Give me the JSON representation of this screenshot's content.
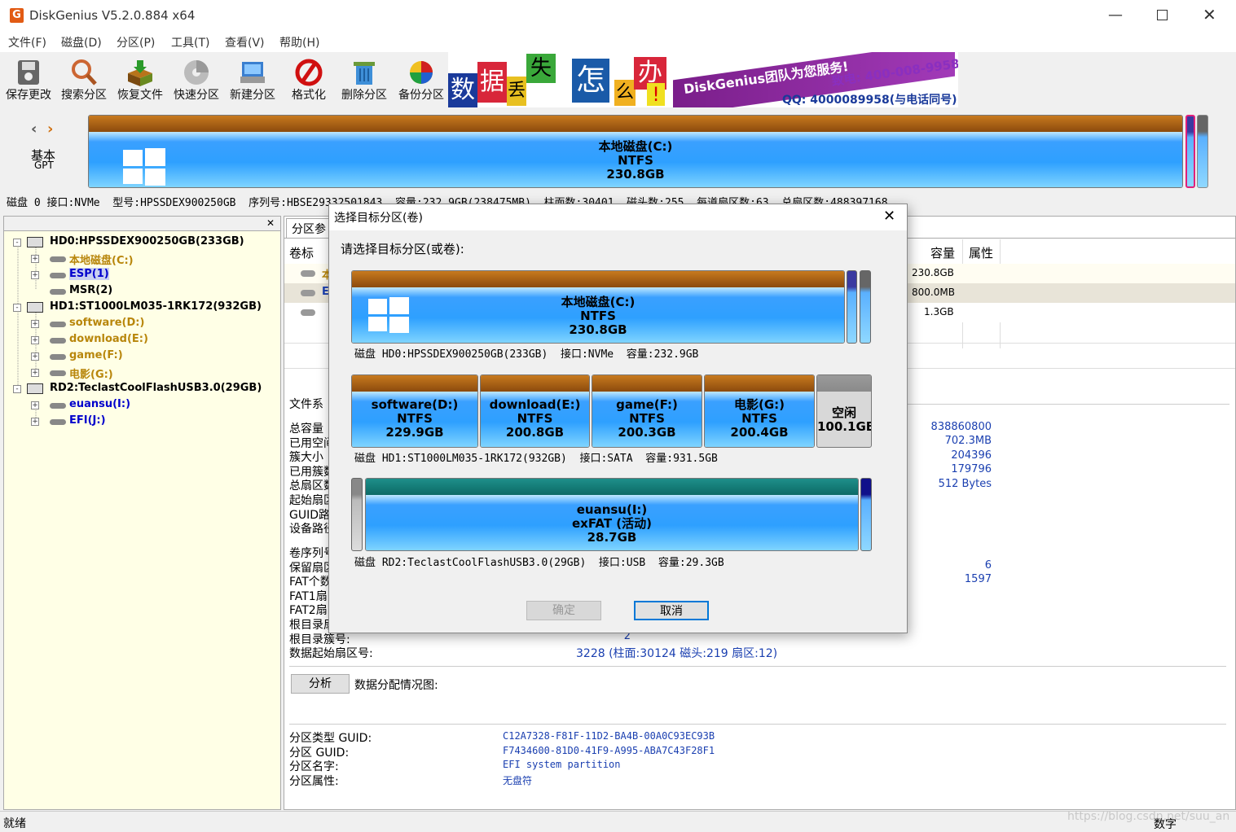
{
  "app": {
    "title": "DiskGenius V5.2.0.884 x64"
  },
  "menu": [
    "文件(F)",
    "磁盘(D)",
    "分区(P)",
    "工具(T)",
    "查看(V)",
    "帮助(H)"
  ],
  "toolbar": {
    "items": [
      "保存更改",
      "搜索分区",
      "恢复文件",
      "快速分区",
      "新建分区",
      "格式化",
      "删除分区",
      "备份分区"
    ],
    "banner": {
      "chars": [
        "数",
        "据",
        "丢",
        "失",
        "怎",
        "么",
        "办",
        "!"
      ],
      "brand": "DiskGenius团队为您服务!",
      "phone": "致电: 400-008-9958",
      "qq": "QQ: 4000089958(与电话同号)"
    }
  },
  "diskmap": {
    "nav_label": "基本",
    "nav_sub": "GPT",
    "partition_name": "本地磁盘(C:)",
    "partition_fs": "NTFS",
    "partition_size": "230.8GB"
  },
  "diskinfo": "磁盘 0 接口:NVMe  型号:HPSSDEX900250GB  序列号:HBSE29332501843  容量:232.9GB(238475MB)  柱面数:30401  磁头数:255  每道扇区数:63  总扇区数:488397168",
  "tree": [
    {
      "label": "HD0:HPSSDEX900250GB(233GB)",
      "color": "k"
    },
    {
      "label": "本地磁盘(C:)",
      "color": "o"
    },
    {
      "label": "ESP(1)",
      "color": "b"
    },
    {
      "label": "MSR(2)",
      "color": "k"
    },
    {
      "label": "HD1:ST1000LM035-1RK172(932GB)",
      "color": "k"
    },
    {
      "label": "software(D:)",
      "color": "o"
    },
    {
      "label": "download(E:)",
      "color": "o"
    },
    {
      "label": "game(F:)",
      "color": "o"
    },
    {
      "label": "电影(G:)",
      "color": "o"
    },
    {
      "label": "RD2:TeclastCoolFlashUSB3.0(29GB)",
      "color": "k"
    },
    {
      "label": "euansu(I:)",
      "color": "b"
    },
    {
      "label": "EFI(J:)",
      "color": "b"
    }
  ],
  "right": {
    "tab": "分区参",
    "col_vol": "卷标",
    "col_cap": "容量",
    "col_attr": "属性",
    "rows": [
      {
        "label": "本",
        "cap": "230.8GB"
      },
      {
        "label": "E",
        "cap": "800.0MB"
      },
      {
        "label": "",
        "cap": "1.3GB"
      }
    ],
    "fs_label": "文件系",
    "params": [
      "总容量",
      "已用空间",
      "簇大小",
      "已用簇数",
      "总扇区数",
      "起始扇区",
      "GUID路径",
      "设备路径"
    ],
    "param_vals": [
      "838860800",
      "702.3MB",
      "204396",
      "179796",
      "512 Bytes"
    ],
    "params2": [
      "卷序列号",
      "保留扇区",
      "FAT个数",
      "FAT1扇区",
      "FAT2扇区",
      "根目录扇",
      "根目录簇号:",
      "数据起始扇区号:"
    ],
    "param2_vals": [
      "6",
      "1597"
    ],
    "root_cluster": "2",
    "data_start": "3228 (柱面:30124 磁头:219 扇区:12)",
    "analyze_btn": "分析",
    "alloc_label": "数据分配情况图:",
    "guid_labels": [
      "分区类型 GUID:",
      "分区 GUID:",
      "分区名字:",
      "分区属性:"
    ],
    "guid_vals": [
      "C12A7328-F81F-11D2-BA4B-00A0C93EC93B",
      "F7434600-81D0-41F9-A995-ABA7C43F28F1",
      "EFI system partition",
      "无盘符"
    ]
  },
  "dialog": {
    "title": "选择目标分区(卷)",
    "prompt": "请选择目标分区(或卷):",
    "disk0": {
      "name": "本地磁盘(C:)",
      "fs": "NTFS",
      "size": "230.8GB",
      "info": "磁盘 HD0:HPSSDEX900250GB(233GB)  接口:NVMe  容量:232.9GB"
    },
    "disk1": {
      "parts": [
        {
          "name": "software(D:)",
          "fs": "NTFS",
          "size": "229.9GB"
        },
        {
          "name": "download(E:)",
          "fs": "NTFS",
          "size": "200.8GB"
        },
        {
          "name": "game(F:)",
          "fs": "NTFS",
          "size": "200.3GB"
        },
        {
          "name": "电影(G:)",
          "fs": "NTFS",
          "size": "200.4GB"
        }
      ],
      "free_label": "空闲",
      "free_size": "100.1GB",
      "info": "磁盘 HD1:ST1000LM035-1RK172(932GB)  接口:SATA  容量:931.5GB"
    },
    "disk2": {
      "name": "euansu(I:)",
      "fs": "exFAT (活动)",
      "size": "28.7GB",
      "info": "磁盘 RD2:TeclastCoolFlashUSB3.0(29GB)  接口:USB  容量:29.3GB"
    },
    "ok": "确定",
    "cancel": "取消"
  },
  "status": {
    "left": "就绪",
    "right": "数字",
    "watermark": "https://blog.csdn.net/suu_an"
  }
}
